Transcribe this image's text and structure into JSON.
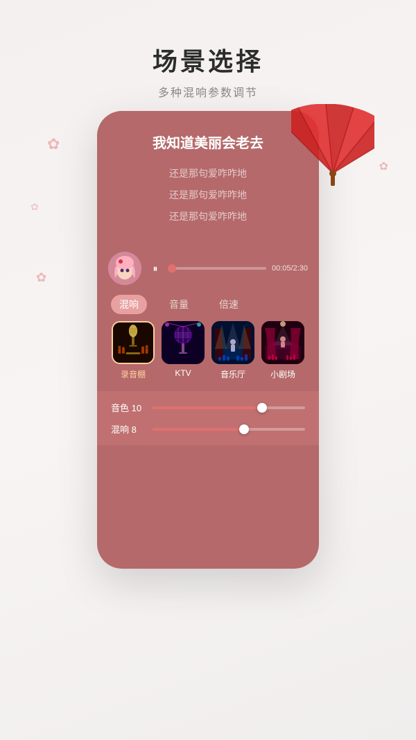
{
  "page": {
    "title": "场景选择",
    "subtitle": "多种混响参数调节"
  },
  "decorations": {
    "sakura_color": "#e8a0a0",
    "fan_color": "#cc2222"
  },
  "player": {
    "avatar_emoji": "🌸",
    "play_icon": "⏸",
    "time_current": "00:05",
    "time_total": "2:30",
    "time_label": "00:05/2:30",
    "progress_percent": 4
  },
  "lyrics": {
    "main": "我知道美丽会老去",
    "line1": "还是那句爱咋咋地",
    "line2": "还是那句爱咋咋地",
    "line3": "还是那句爱咋咋地"
  },
  "tabs": [
    {
      "id": "reverb",
      "label": "混响",
      "active": true
    },
    {
      "id": "volume",
      "label": "音量",
      "active": false
    },
    {
      "id": "speed",
      "label": "倍速",
      "active": false
    }
  ],
  "scenes": [
    {
      "id": "recording",
      "label": "录音棚",
      "active": true,
      "icon": "🎙️"
    },
    {
      "id": "ktv",
      "label": "KTV",
      "active": false,
      "icon": "🎤"
    },
    {
      "id": "music-hall",
      "label": "音乐厅",
      "active": false,
      "icon": "🎵"
    },
    {
      "id": "theater",
      "label": "小剧场",
      "active": false,
      "icon": "🎭"
    }
  ],
  "eq": [
    {
      "id": "tone",
      "label": "音色 10",
      "fill_percent": 72
    },
    {
      "id": "reverb",
      "label": "混响 8",
      "fill_percent": 60
    }
  ],
  "colors": {
    "primary": "#b5696a",
    "accent": "#e07070",
    "tab_active_bg": "#e8a0a0",
    "eq_area_bg": "#c07070"
  }
}
